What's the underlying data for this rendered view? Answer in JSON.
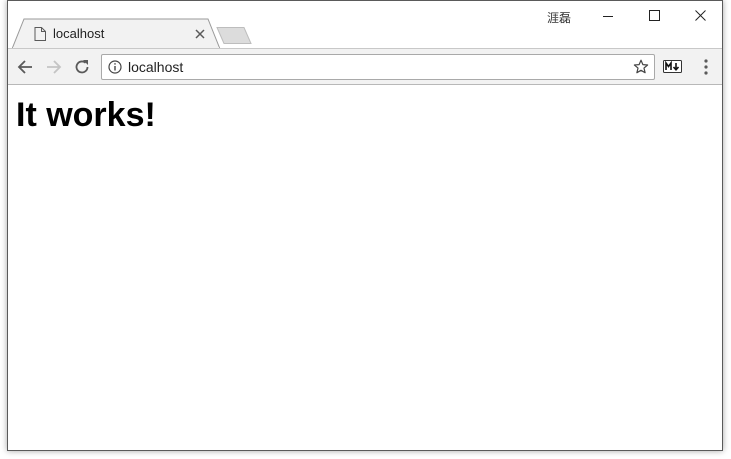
{
  "tab": {
    "title": "localhost"
  },
  "titlebar": {
    "ime_indicator": "涯磊"
  },
  "toolbar": {
    "url_value": "localhost",
    "extension_label": "M↓"
  },
  "page": {
    "heading": "It works!"
  },
  "icons": {
    "tab": "page-icon",
    "tab_close": "close-icon",
    "back": "arrow-left-icon",
    "forward": "arrow-right-icon",
    "reload": "reload-icon",
    "info": "info-icon",
    "bookmark": "star-icon",
    "extension": "markdown-icon",
    "menu": "kebab-menu-icon",
    "minimize": "minimize-icon",
    "maximize": "maximize-icon",
    "close": "close-icon"
  },
  "colors": {
    "toolbar_bg": "#f2f2f2",
    "tab_bg": "#f2f2f2",
    "forward_disabled": "#c4c4c4",
    "icon": "#5a5a5a"
  }
}
